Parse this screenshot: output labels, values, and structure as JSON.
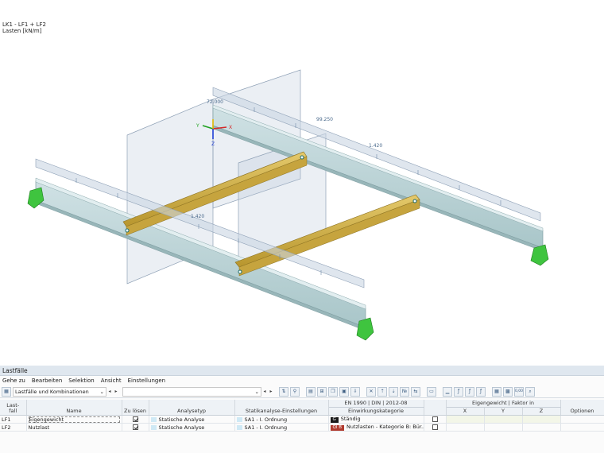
{
  "viewport": {
    "combo_label": "LK1 - LF1 + LF2",
    "units_label": "Lasten [kN/m]",
    "load_values": [
      "72.000",
      "99.250",
      "1.420",
      "1.420"
    ],
    "axes": {
      "x": "X",
      "y": "Y",
      "z": "Z"
    }
  },
  "panel": {
    "title": "Lastfälle",
    "menu": [
      "Gehe zu",
      "Bearbeiten",
      "Selektion",
      "Ansicht",
      "Einstellungen"
    ],
    "view_selector": "Lastfälle und Kombinationen",
    "zoom_toolbar_label": "0,00",
    "table": {
      "headers": {
        "lastfall": "Last-\nfall",
        "name": "Name",
        "zu_loesen": "Zu lösen",
        "analysetyp": "Analysetyp",
        "statik": "Statikanalyse-Einstellungen",
        "einwirkung_top": "EN 1990 | DIN | 2012-08",
        "einwirkung": "Einwirkungskategorie",
        "eigengewicht_group": "Eigengewicht | Faktor in",
        "x": "X",
        "y": "Y",
        "z": "Z",
        "optionen": "Optionen"
      },
      "rows": [
        {
          "id": "LF1",
          "name": "Eigengewicht",
          "solve": true,
          "analysis": "Statische Analyse",
          "settings": "SA1 - I. Ordnung",
          "cat_code": "G",
          "cat_color": "#1a1a1a",
          "category": "Ständig",
          "flag": false
        },
        {
          "id": "LF2",
          "name": "Nutzlast",
          "solve": true,
          "analysis": "Statische Analyse",
          "settings": "SA1 - I. Ordnung",
          "cat_code": "QI B",
          "cat_color": "#b03a2e",
          "category": "Nutzlasten - Kategorie B: Bür...",
          "flag": false
        }
      ]
    },
    "colors": {
      "analysis_swatch": "#cfe9f5",
      "settings_swatch": "#cfe9f5"
    }
  }
}
